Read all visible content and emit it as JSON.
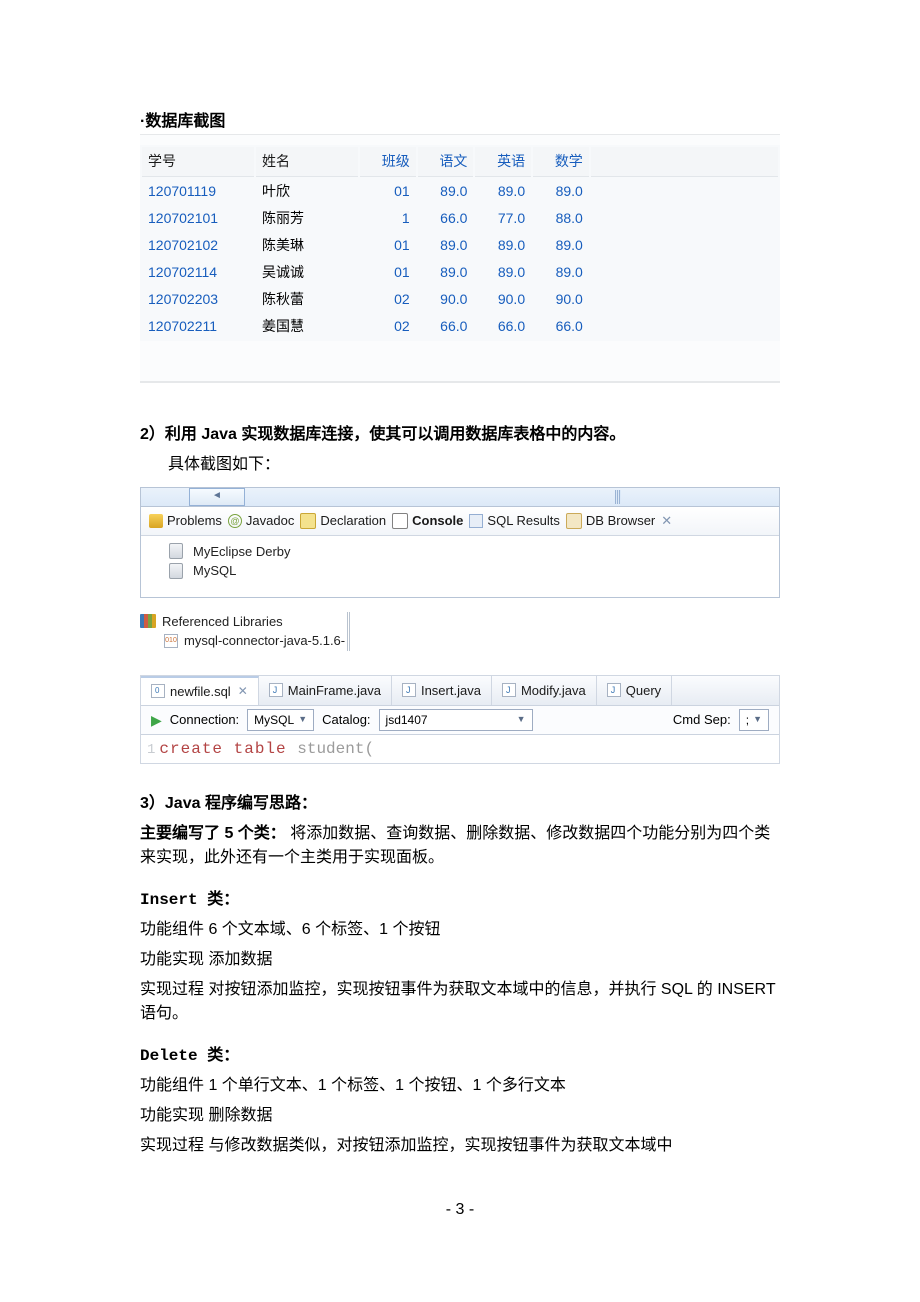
{
  "sec1_heading": "·数据库截图",
  "db": {
    "headers": [
      "学号",
      "姓名",
      "班级",
      "语文",
      "英语",
      "数学"
    ],
    "rows": [
      {
        "id": "120701119",
        "name": "叶欣",
        "class": "01",
        "yw": "89.0",
        "yy": "89.0",
        "sx": "89.0"
      },
      {
        "id": "120702101",
        "name": "陈丽芳",
        "class": "1",
        "yw": "66.0",
        "yy": "77.0",
        "sx": "88.0"
      },
      {
        "id": "120702102",
        "name": "陈美琳",
        "class": "01",
        "yw": "89.0",
        "yy": "89.0",
        "sx": "89.0"
      },
      {
        "id": "120702114",
        "name": "吴诚诚",
        "class": "01",
        "yw": "89.0",
        "yy": "89.0",
        "sx": "89.0"
      },
      {
        "id": "120702203",
        "name": "陈秋蕾",
        "class": "02",
        "yw": "90.0",
        "yy": "90.0",
        "sx": "90.0"
      },
      {
        "id": "120702211",
        "name": "姜国慧",
        "class": "02",
        "yw": "66.0",
        "yy": "66.0",
        "sx": "66.0"
      }
    ]
  },
  "sec2_heading": "2）利用 Java 实现数据库连接，使其可以调用数据库表格中的内容。",
  "sec2_sub": "具体截图如下：",
  "eclipse": {
    "tabs": {
      "problems": "Problems",
      "javadoc": "Javadoc",
      "declaration": "Declaration",
      "console": "Console",
      "sqlresults": "SQL Results",
      "dbbrowser": "DB Browser"
    },
    "tree": {
      "item1": "MyEclipse Derby",
      "item2": "MySQL"
    }
  },
  "reflib": {
    "title": "Referenced Libraries",
    "item": "mysql-connector-java-5.1.6-"
  },
  "editor": {
    "tabs": {
      "t1": "newfile.sql",
      "t2": "MainFrame.java",
      "t3": "Insert.java",
      "t4": "Modify.java",
      "t5": "Query"
    },
    "conn_label": "Connection:",
    "conn_value": "MySQL",
    "catalog_label": "Catalog:",
    "catalog_value": "jsd1407",
    "cmdsep_label": "Cmd Sep:",
    "cmdsep_value": ";",
    "sql_lineno": "1",
    "sql_kw": "create table ",
    "sql_ident": "student("
  },
  "sec3_heading": "3）Java 程序编写思路：",
  "sec3_line1a": "主要编写了 5 个类：",
  "sec3_line1b": " 将添加数据、查询数据、删除数据、修改数据四个功能分别为四个类来实现，此外还有一个主类用于实现面板。",
  "insert": {
    "title": "Insert 类：",
    "l1": "功能组件   6 个文本域、6 个标签、1 个按钮",
    "l2": "功能实现   添加数据",
    "l3": "实现过程   对按钮添加监控，实现按钮事件为获取文本域中的信息，并执行 SQL 的 INSERT 语句。"
  },
  "delete": {
    "title": "Delete 类：",
    "l1": "功能组件   1 个单行文本、1 个标签、1 个按钮、1 个多行文本",
    "l2": "功能实现   删除数据",
    "l3": "实现过程   与修改数据类似，对按钮添加监控，实现按钮事件为获取文本域中"
  },
  "page_number": "- 3 -"
}
